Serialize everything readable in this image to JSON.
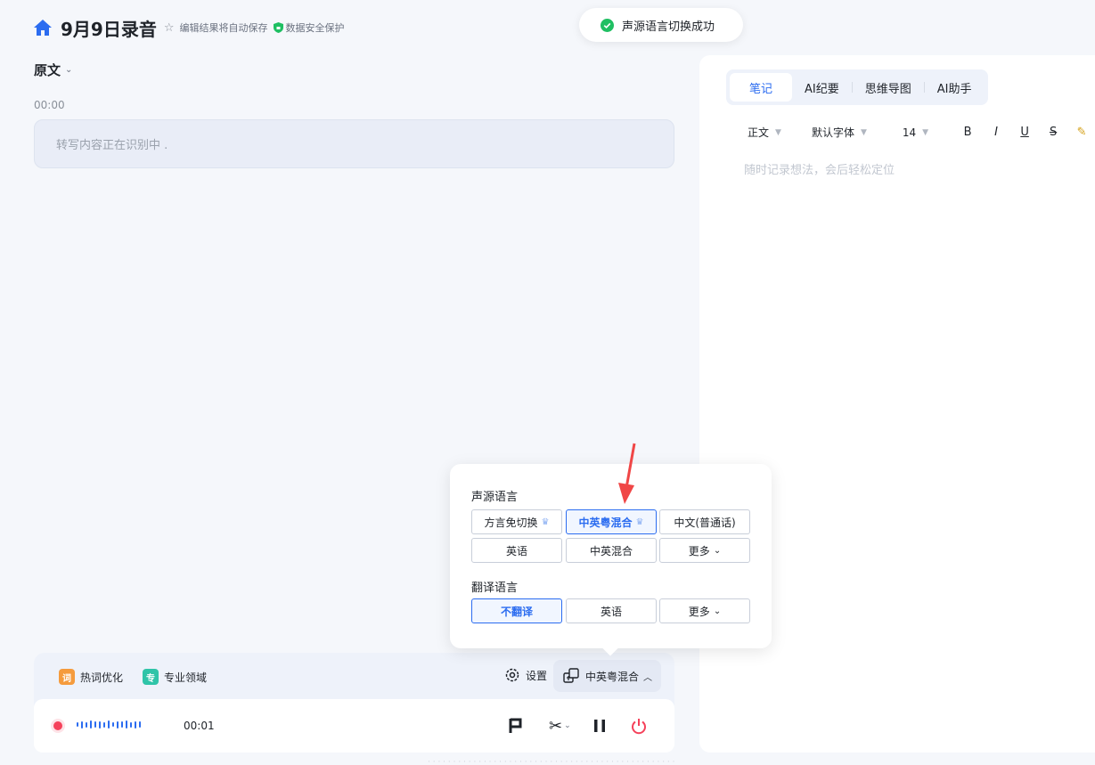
{
  "header": {
    "title": "9月9日录音",
    "autosave_text": "编辑结果将自动保存",
    "secure_text": "数据安全保护"
  },
  "toast": {
    "message": "声源语言切换成功"
  },
  "left": {
    "section_title": "原文",
    "timestamp": "00:00",
    "transcript_status": "转写内容正在识别中 ."
  },
  "right": {
    "tabs": [
      {
        "label": "笔记",
        "active": true
      },
      {
        "label": "AI纪要"
      },
      {
        "label": "思维导图"
      },
      {
        "label": "AI助手"
      }
    ],
    "toolbar": {
      "paragraph": "正文",
      "font": "默认字体",
      "size": "14",
      "bold": "B",
      "italic": "I",
      "underline": "U",
      "strike": "S"
    },
    "placeholder": "随时记录想法，会后轻松定位"
  },
  "bottom": {
    "hotword_icon": "词",
    "hotword_label": "热词优化",
    "domain_icon": "专",
    "domain_label": "专业领域",
    "settings_label": "设置",
    "language_label": "中英粤混合",
    "elapsed": "00:01"
  },
  "popup": {
    "source_title": "声源语言",
    "source_options": [
      "方言免切换",
      "中英粤混合",
      "中文(普通话)",
      "英语",
      "中英混合",
      "更多"
    ],
    "source_selected": "中英粤混合",
    "translate_title": "翻译语言",
    "translate_options": [
      "不翻译",
      "英语",
      "更多"
    ],
    "translate_selected": "不翻译"
  },
  "colors": {
    "accent": "#2b6cf0",
    "record": "#f5415a",
    "success": "#1fbf62",
    "hotword": "#f59b3d",
    "domain": "#2fc4a8"
  },
  "icons": [
    "home-icon",
    "star-icon",
    "shield-icon",
    "check-circle-icon",
    "settings-gear-icon",
    "language-switch-icon",
    "flag-icon",
    "scissors-icon",
    "pause-icon",
    "power-icon",
    "crown-icon"
  ]
}
